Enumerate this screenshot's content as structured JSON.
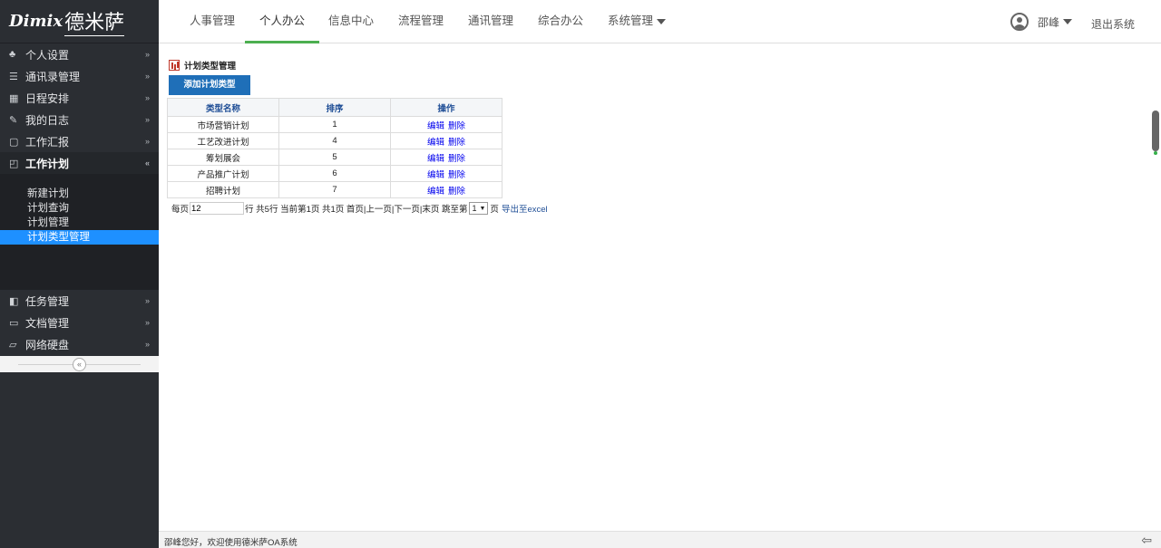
{
  "logo": {
    "en": "Dimix",
    "cn": "德米萨"
  },
  "sidebar": {
    "items_top": [
      {
        "icon": "♣",
        "label": "个人设置",
        "chevron": "»"
      },
      {
        "icon": "☰",
        "label": "通讯录管理",
        "chevron": "»"
      },
      {
        "icon": "▦",
        "label": "日程安排",
        "chevron": "»"
      },
      {
        "icon": "✎",
        "label": "我的日志",
        "chevron": "»"
      },
      {
        "icon": "▢",
        "label": "工作汇报",
        "chevron": "»"
      },
      {
        "icon": "◰",
        "label": "工作计划",
        "chevron": "«"
      }
    ],
    "submenu": [
      "新建计划",
      "计划查询",
      "计划管理",
      "计划类型管理"
    ],
    "submenu_active": "计划类型管理",
    "items_bottom": [
      {
        "icon": "◧",
        "label": "任务管理",
        "chevron": "»"
      },
      {
        "icon": "▭",
        "label": "文档管理",
        "chevron": "»"
      },
      {
        "icon": "▱",
        "label": "网络硬盘",
        "chevron": "»"
      }
    ],
    "collapse_symbol": "«"
  },
  "nav": {
    "tabs": [
      "人事管理",
      "个人办公",
      "信息中心",
      "流程管理",
      "通讯管理",
      "综合办公",
      "系统管理"
    ],
    "active": "个人办公",
    "user": "邵峰",
    "logout": "退出系统"
  },
  "main": {
    "title": "计划类型管理",
    "add_button": "添加计划类型",
    "columns": [
      "类型名称",
      "排序",
      "操作"
    ],
    "rows": [
      {
        "name": "市场营销计划",
        "order": "1"
      },
      {
        "name": "工艺改进计划",
        "order": "4"
      },
      {
        "name": "筹划展会",
        "order": "5"
      },
      {
        "name": "产品推广计划",
        "order": "6"
      },
      {
        "name": "招聘计划",
        "order": "7"
      }
    ],
    "actions": {
      "edit": "编辑",
      "delete": "删除"
    },
    "pager": {
      "per_page_label": "每页",
      "per_page_value": "12",
      "summary": "行 共5行  当前第1页  共1页  首页|上一页|下一页|末页  跳至第",
      "page_value": "1",
      "page_suffix": "页",
      "export": "导出至excel"
    }
  },
  "footer": {
    "message": "邵峰您好，欢迎使用德米萨OA系统",
    "back_symbol": "⇦"
  }
}
